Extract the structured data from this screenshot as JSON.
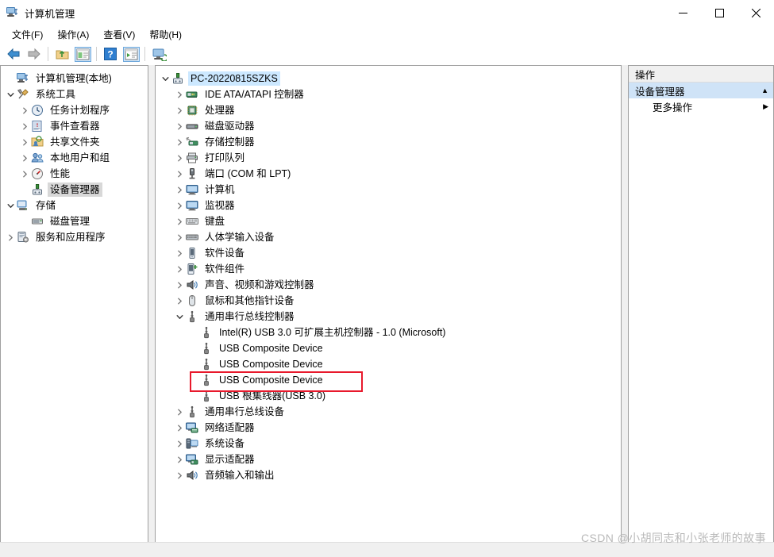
{
  "window": {
    "title": "计算机管理",
    "icon": "computer-management-icon",
    "minimize": "—",
    "maximize": "☐",
    "close": "✕"
  },
  "menubar": {
    "items": [
      {
        "label": "文件(F)",
        "name": "menu-file"
      },
      {
        "label": "操作(A)",
        "name": "menu-action"
      },
      {
        "label": "查看(V)",
        "name": "menu-view"
      },
      {
        "label": "帮助(H)",
        "name": "menu-help"
      }
    ]
  },
  "toolbar": {
    "buttons": [
      {
        "name": "back-arrow-icon",
        "title": "后退"
      },
      {
        "name": "forward-arrow-icon",
        "title": "前进"
      },
      {
        "name": "up-folder-icon",
        "title": "上移一级"
      },
      {
        "name": "show-hide-tree-icon",
        "title": "显示/隐藏控制台树"
      },
      {
        "name": "help-icon",
        "title": "帮助"
      },
      {
        "name": "properties-icon",
        "title": "属性"
      },
      {
        "name": "refresh-monitor-icon",
        "title": "刷新"
      }
    ]
  },
  "console_tree": {
    "items": [
      {
        "label": "计算机管理(本地)",
        "depth": 0,
        "chevron": "none",
        "icon": "computer-management-icon",
        "selected": "none"
      },
      {
        "label": "系统工具",
        "depth": 0,
        "chevron": "open",
        "icon": "system-tools-icon",
        "selected": "none"
      },
      {
        "label": "任务计划程序",
        "depth": 1,
        "chevron": "closed",
        "icon": "task-scheduler-icon",
        "selected": "none"
      },
      {
        "label": "事件查看器",
        "depth": 1,
        "chevron": "closed",
        "icon": "event-viewer-icon",
        "selected": "none"
      },
      {
        "label": "共享文件夹",
        "depth": 1,
        "chevron": "closed",
        "icon": "shared-folders-icon",
        "selected": "none"
      },
      {
        "label": "本地用户和组",
        "depth": 1,
        "chevron": "closed",
        "icon": "local-users-groups-icon",
        "selected": "none"
      },
      {
        "label": "性能",
        "depth": 1,
        "chevron": "closed",
        "icon": "performance-icon",
        "selected": "none"
      },
      {
        "label": "设备管理器",
        "depth": 1,
        "chevron": "none",
        "icon": "device-manager-icon",
        "selected": "inactive"
      },
      {
        "label": "存储",
        "depth": 0,
        "chevron": "open",
        "icon": "storage-icon",
        "selected": "none"
      },
      {
        "label": "磁盘管理",
        "depth": 1,
        "chevron": "none",
        "icon": "disk-management-icon",
        "selected": "none"
      },
      {
        "label": "服务和应用程序",
        "depth": 0,
        "chevron": "closed",
        "icon": "services-apps-icon",
        "selected": "none"
      }
    ]
  },
  "device_tree": {
    "items": [
      {
        "label": "PC-20220815SZKS",
        "depth": 0,
        "chevron": "open",
        "icon": "computer-root-icon",
        "selected": "active"
      },
      {
        "label": "IDE ATA/ATAPI 控制器",
        "depth": 1,
        "chevron": "closed",
        "icon": "ide-controller-icon",
        "selected": "none"
      },
      {
        "label": "处理器",
        "depth": 1,
        "chevron": "closed",
        "icon": "processor-icon",
        "selected": "none"
      },
      {
        "label": "磁盘驱动器",
        "depth": 1,
        "chevron": "closed",
        "icon": "disk-drive-icon",
        "selected": "none"
      },
      {
        "label": "存储控制器",
        "depth": 1,
        "chevron": "closed",
        "icon": "storage-controller-icon",
        "selected": "none"
      },
      {
        "label": "打印队列",
        "depth": 1,
        "chevron": "closed",
        "icon": "print-queue-icon",
        "selected": "none"
      },
      {
        "label": "端口 (COM 和 LPT)",
        "depth": 1,
        "chevron": "closed",
        "icon": "ports-icon",
        "selected": "none"
      },
      {
        "label": "计算机",
        "depth": 1,
        "chevron": "closed",
        "icon": "computer-icon",
        "selected": "none"
      },
      {
        "label": "监视器",
        "depth": 1,
        "chevron": "closed",
        "icon": "monitor-icon",
        "selected": "none"
      },
      {
        "label": "键盘",
        "depth": 1,
        "chevron": "closed",
        "icon": "keyboard-icon",
        "selected": "none"
      },
      {
        "label": "人体学输入设备",
        "depth": 1,
        "chevron": "closed",
        "icon": "hid-icon",
        "selected": "none"
      },
      {
        "label": "软件设备",
        "depth": 1,
        "chevron": "closed",
        "icon": "software-device-icon",
        "selected": "none"
      },
      {
        "label": "软件组件",
        "depth": 1,
        "chevron": "closed",
        "icon": "software-component-icon",
        "selected": "none"
      },
      {
        "label": "声音、视频和游戏控制器",
        "depth": 1,
        "chevron": "closed",
        "icon": "sound-video-game-icon",
        "selected": "none"
      },
      {
        "label": "鼠标和其他指针设备",
        "depth": 1,
        "chevron": "closed",
        "icon": "mouse-icon",
        "selected": "none"
      },
      {
        "label": "通用串行总线控制器",
        "depth": 1,
        "chevron": "open",
        "icon": "usb-icon",
        "selected": "none"
      },
      {
        "label": "Intel(R) USB 3.0 可扩展主机控制器 - 1.0 (Microsoft)",
        "depth": 2,
        "chevron": "none",
        "icon": "usb-icon",
        "selected": "none"
      },
      {
        "label": "USB Composite Device",
        "depth": 2,
        "chevron": "none",
        "icon": "usb-icon",
        "selected": "none"
      },
      {
        "label": "USB Composite Device",
        "depth": 2,
        "chevron": "none",
        "icon": "usb-icon",
        "selected": "none"
      },
      {
        "label": "USB Composite Device",
        "depth": 2,
        "chevron": "none",
        "icon": "usb-icon",
        "selected": "none",
        "highlight": true
      },
      {
        "label": "USB 根集线器(USB 3.0)",
        "depth": 2,
        "chevron": "none",
        "icon": "usb-icon",
        "selected": "none"
      },
      {
        "label": "通用串行总线设备",
        "depth": 1,
        "chevron": "closed",
        "icon": "usb-icon",
        "selected": "none"
      },
      {
        "label": "网络适配器",
        "depth": 1,
        "chevron": "closed",
        "icon": "network-adapter-icon",
        "selected": "none"
      },
      {
        "label": "系统设备",
        "depth": 1,
        "chevron": "closed",
        "icon": "system-device-icon",
        "selected": "none"
      },
      {
        "label": "显示适配器",
        "depth": 1,
        "chevron": "closed",
        "icon": "display-adapter-icon",
        "selected": "none"
      },
      {
        "label": "音频输入和输出",
        "depth": 1,
        "chevron": "closed",
        "icon": "audio-io-icon",
        "selected": "none"
      }
    ]
  },
  "actions_pane": {
    "header": "操作",
    "group_title": "设备管理器",
    "group_collapse_glyph": "▲",
    "items": [
      {
        "label": "更多操作",
        "arrow": "▶",
        "name": "action-more-actions"
      }
    ]
  },
  "annotation": {
    "highlight_color": "#e8192c",
    "target_label": "USB Composite Device"
  },
  "watermark": {
    "text": "CSDN @小胡同志和小张老师的故事",
    "color": "#b9b9b9"
  },
  "colors": {
    "selection_active": "#cce8ff",
    "selection_inactive": "#d8d8d8",
    "actions_group": "#cfe3f7",
    "chrome": "#f0f0f0"
  }
}
